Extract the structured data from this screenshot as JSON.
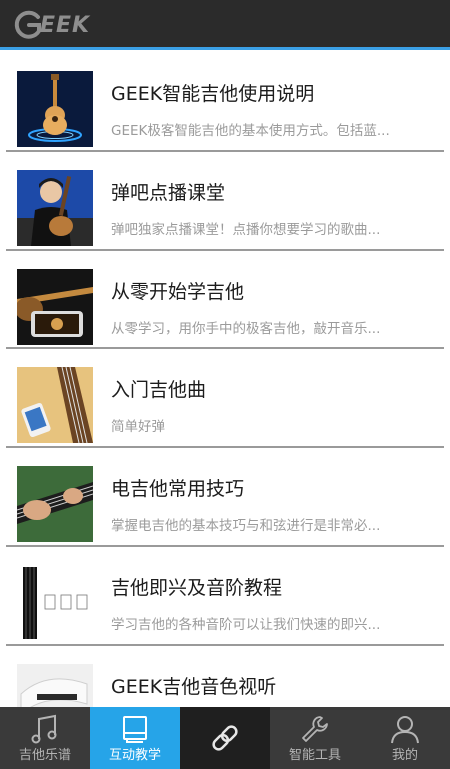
{
  "header": {
    "logo_text": "EEK"
  },
  "items": [
    {
      "title": "GEEK智能吉他使用说明",
      "desc": "GEEK极客智能吉他的基本使用方式。包括蓝...",
      "thumb": "guitar-hologram"
    },
    {
      "title": "弹吧点播课堂",
      "desc": "弹吧独家点播课堂！点播你想要学习的歌曲...",
      "thumb": "guitarist-portrait"
    },
    {
      "title": "从零开始学吉他",
      "desc": "从零学习，用你手中的极客吉他，敲开音乐...",
      "thumb": "guitar-phone"
    },
    {
      "title": "入门吉他曲",
      "desc": "简单好弹",
      "thumb": "guitar-neck-phone"
    },
    {
      "title": "电吉他常用技巧",
      "desc": "掌握电吉他的基本技巧与和弦进行是非常必...",
      "thumb": "electric-guitar-hands"
    },
    {
      "title": "吉他即兴及音阶教程",
      "desc": "学习吉他的各种音阶可以让我们快速的即兴...",
      "thumb": "scale-chart"
    },
    {
      "title": "GEEK吉他音色视听",
      "desc": "",
      "thumb": "guitar-body-white"
    }
  ],
  "tabs": [
    {
      "label": "吉他乐谱",
      "icon": "music-note-icon",
      "active": false
    },
    {
      "label": "互动教学",
      "icon": "book-icon",
      "active": true
    },
    {
      "label": "",
      "icon": "link-icon",
      "active": false
    },
    {
      "label": "智能工具",
      "icon": "wrench-icon",
      "active": false
    },
    {
      "label": "我的",
      "icon": "person-icon",
      "active": false
    }
  ],
  "colors": {
    "accent": "#26a4e8",
    "topbar": "#2b2b2b",
    "tabbar": "#3a3a3a"
  }
}
